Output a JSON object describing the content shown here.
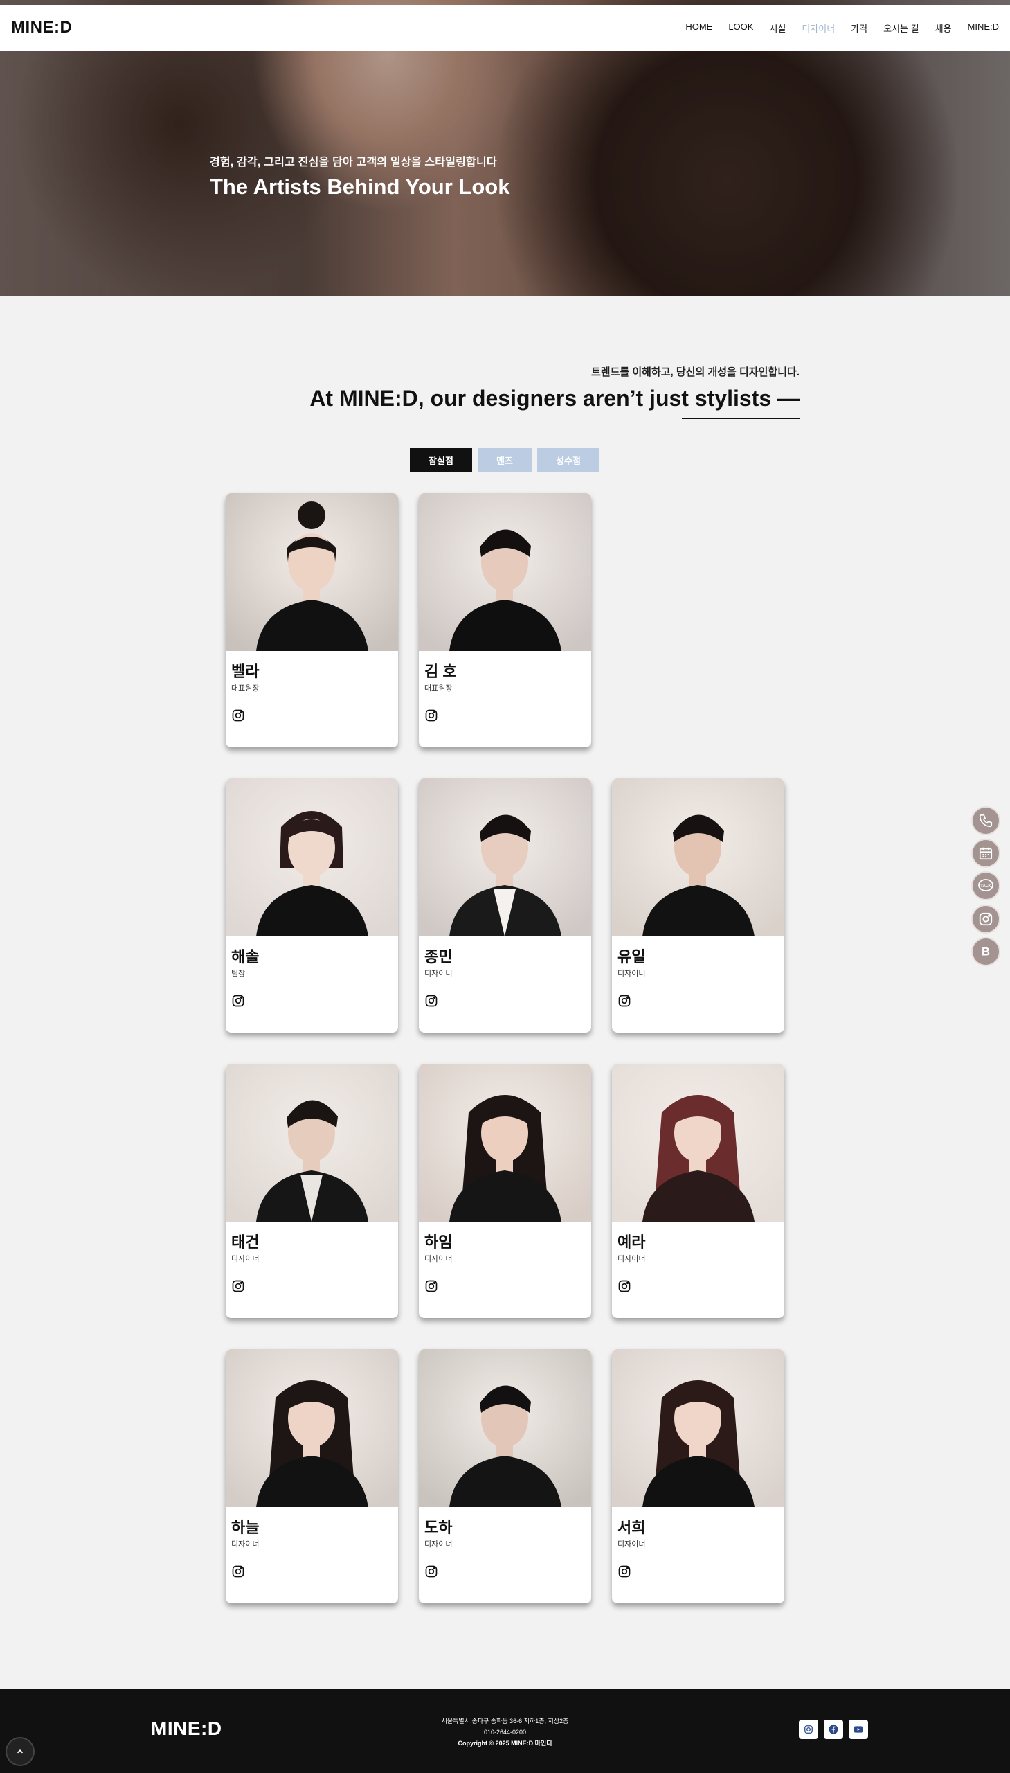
{
  "header": {
    "logo": "MINE:D",
    "nav": [
      "HOME",
      "LOOK",
      "시설",
      "디자이너",
      "가격",
      "오시는 길",
      "채용",
      "MINE:D"
    ],
    "active_index": 3
  },
  "hero": {
    "subtitle": "경험, 감각, 그리고 진심을 담아 고객의 일상을 스타일링합니다",
    "title": "The Artists Behind Your Look"
  },
  "intro": {
    "subtitle": "트렌드를 이해하고, 당신의 개성을 디자인합니다.",
    "title": "At MINE:D, our designers aren’t just stylists —"
  },
  "branch_tabs": [
    "잠실점",
    "멘즈",
    "성수점"
  ],
  "designers": [
    {
      "name": "벨라",
      "role": "대표원장",
      "look": "f-updo"
    },
    {
      "name": "김 호",
      "role": "대표원장",
      "look": "m-profile"
    },
    {
      "name": "해솔",
      "role": "팀장",
      "look": "f-short"
    },
    {
      "name": "종민",
      "role": "디자이너",
      "look": "m-suit"
    },
    {
      "name": "유일",
      "role": "디자이너",
      "look": "m-casual"
    },
    {
      "name": "태건",
      "role": "디자이너",
      "look": "m-jacket"
    },
    {
      "name": "하임",
      "role": "디자이너",
      "look": "f-long"
    },
    {
      "name": "예라",
      "role": "디자이너",
      "look": "f-red"
    },
    {
      "name": "하늘",
      "role": "디자이너",
      "look": "f-straight"
    },
    {
      "name": "도하",
      "role": "디자이너",
      "look": "m-dark"
    },
    {
      "name": "서희",
      "role": "디자이너",
      "look": "f-wavy"
    }
  ],
  "floating": [
    "phone-icon",
    "calendar-icon",
    "talk-icon",
    "instagram-icon",
    "blog-icon"
  ],
  "footer": {
    "logo": "MINE:D",
    "address": "서울특별시 송파구 송파동 36-6 지하1층, 지상2층",
    "phone": "010-2644-0200",
    "copyright": "Copyright © 2025 MINE:D 마인디",
    "social": [
      "instagram-icon",
      "facebook-icon",
      "youtube-icon"
    ]
  },
  "colors": {
    "accent_inactive": "#bccde3",
    "nav_active": "#9fb4cf",
    "float_button": "#a39391",
    "footer_bg": "#111111"
  }
}
